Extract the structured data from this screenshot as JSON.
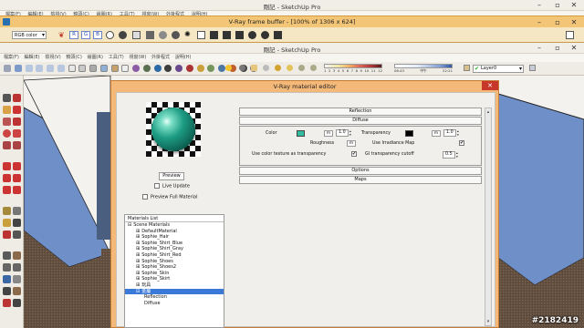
{
  "back_window": {
    "title": "剛記 - SketchUp Pro",
    "menu": [
      "檔案(F)",
      "編輯(E)",
      "檢視(V)",
      "鏡頭(C)",
      "繪圖(R)",
      "工具(T)",
      "視窗(W)",
      "外掛程式",
      "說明(H)"
    ]
  },
  "frame_buffer": {
    "title": "V-Ray frame buffer - [100% of 1306 x 624]",
    "channel_select": "RGB color",
    "channels": [
      "R",
      "G",
      "B"
    ]
  },
  "sketchup": {
    "title": "剛記 - SketchUp Pro",
    "menu": [
      "檔案(F)",
      "編輯(E)",
      "檢視(V)",
      "鏡頭(C)",
      "繪圖(R)",
      "工具(T)",
      "視窗(W)",
      "外掛程式",
      "說明(H)"
    ],
    "sun_slider_ticks": [
      "1",
      "2",
      "3",
      "4",
      "5",
      "6",
      "7",
      "8",
      "9",
      "10",
      "11",
      "12"
    ],
    "time_labels": [
      "06:43",
      "中午",
      "22:21"
    ],
    "layer": "Layer0"
  },
  "material_editor": {
    "title": "V-Ray material editor",
    "close": "✕",
    "preview_button": "Preview",
    "live_update": "Live Update",
    "preview_full": "Preview Full Material",
    "materials_list_header": "Materials List",
    "tree": [
      {
        "label": "Scene Materials",
        "indent": 0,
        "sign": "⊟"
      },
      {
        "label": "DefaultMaterial",
        "indent": 1,
        "sign": "⊞"
      },
      {
        "label": "Sophie_Hair",
        "indent": 1,
        "sign": "⊞"
      },
      {
        "label": "Sophie_Shirt_Blue",
        "indent": 1,
        "sign": "⊞"
      },
      {
        "label": "Sophie_Shirt_Gray",
        "indent": 1,
        "sign": "⊞"
      },
      {
        "label": "Sophie_Shirt_Red",
        "indent": 1,
        "sign": "⊞"
      },
      {
        "label": "Sophie_Shoes",
        "indent": 1,
        "sign": "⊞"
      },
      {
        "label": "Sophie_Shoes2",
        "indent": 1,
        "sign": "⊞"
      },
      {
        "label": "Sophie_Skin",
        "indent": 1,
        "sign": "⊞"
      },
      {
        "label": "Sophie_Skirt",
        "indent": 1,
        "sign": "⊞"
      },
      {
        "label": "玩具",
        "indent": 1,
        "sign": "⊞"
      },
      {
        "label": "金屬",
        "indent": 1,
        "sign": "⊟",
        "selected": true
      },
      {
        "label": "Reflection",
        "indent": 2,
        "sign": ""
      },
      {
        "label": "Diffuse",
        "indent": 2,
        "sign": ""
      }
    ],
    "rollouts": {
      "reflection": "Reflection",
      "diffuse": "Diffuse",
      "options": "Options",
      "maps": "Maps"
    },
    "diffuse": {
      "color_label": "Color",
      "color_value": "#2fbea0",
      "color_amount": "1.0",
      "transparency_label": "Transparency",
      "transparency_value": "#000000",
      "transparency_amount": "1.0",
      "roughness_label": "Roughness",
      "irradiance_label": "Use Irradiance Map",
      "irradiance_checked": true,
      "color_texture_label": "Use color texture as transparency",
      "color_texture_checked": true,
      "gi_cutoff_label": "GI transparency cutoff",
      "gi_cutoff_value": "0.5",
      "map_button": "m"
    }
  },
  "watermark": "#2182419"
}
